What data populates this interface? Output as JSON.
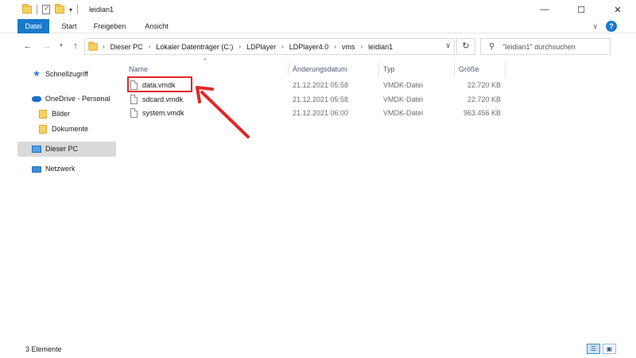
{
  "window": {
    "title": "leidian1",
    "controls": {
      "minimize": "—",
      "maximize": "☐",
      "close": "✕"
    }
  },
  "ribbon": {
    "tabs": [
      "Datei",
      "Start",
      "Freigeben",
      "Ansicht"
    ],
    "active_tab": "Datei",
    "help": "?"
  },
  "address_bar": {
    "breadcrumbs": [
      "Dieser PC",
      "Lokaler Datenträger (C:)",
      "LDPlayer",
      "LDPlayer4.0",
      "vms",
      "leidian1"
    ],
    "search_placeholder": "\"leidian1\" durchsuchen"
  },
  "navigation": {
    "items": [
      {
        "label": "Schnellzugriff",
        "icon": "star-icon"
      },
      {
        "label": "OneDrive - Personal",
        "icon": "cloud-icon"
      },
      {
        "label": "Bilder",
        "icon": "folder-icon"
      },
      {
        "label": "Dokumente",
        "icon": "folder-icon"
      },
      {
        "label": "Dieser PC",
        "icon": "computer-icon",
        "selected": true
      },
      {
        "label": "Netzwerk",
        "icon": "network-icon"
      }
    ]
  },
  "file_list": {
    "columns": [
      "Name",
      "Änderungsdatum",
      "Typ",
      "Größe"
    ],
    "rows": [
      {
        "name": "data.vmdk",
        "date": "21.12.2021 05:58",
        "type": "VMDK-Datei",
        "size": "22.720 KB"
      },
      {
        "name": "sdcard.vmdk",
        "date": "21.12.2021 05:58",
        "type": "VMDK-Datei",
        "size": "22.720 KB"
      },
      {
        "name": "system.vmdk",
        "date": "21.12.2021 06:00",
        "type": "VMDK-Datei",
        "size": "963.456 KB"
      }
    ]
  },
  "annotation": {
    "color": "#e02828"
  },
  "status_bar": {
    "count": "3 Elemente"
  },
  "colors": {
    "accent": "#1979ca",
    "selection": "#d9d9d9",
    "highlight": "#e02828"
  }
}
